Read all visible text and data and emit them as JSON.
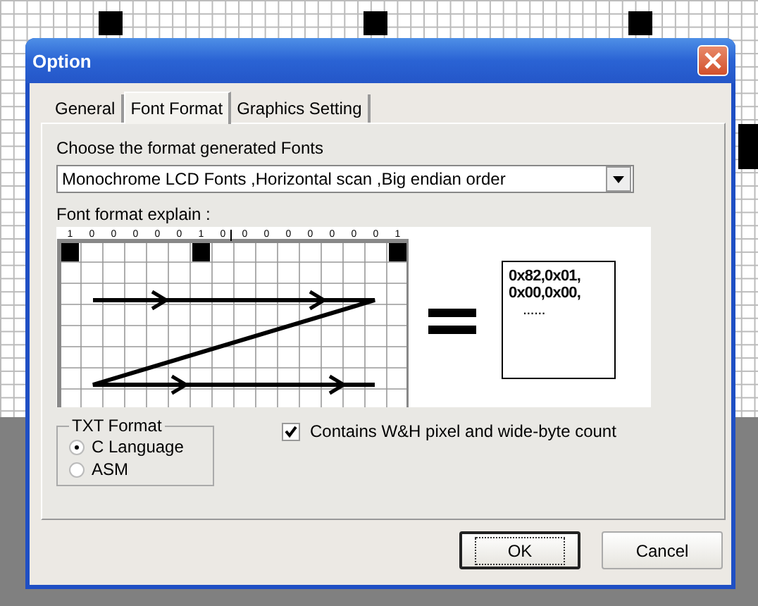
{
  "window": {
    "title": "Option"
  },
  "tabs": [
    {
      "label": "General",
      "selected": false
    },
    {
      "label": "Font Format",
      "selected": true
    },
    {
      "label": "Graphics Setting",
      "selected": false
    }
  ],
  "format": {
    "label": "Choose the format generated Fonts",
    "value": "Monochrome LCD Fonts ,Horizontal scan ,Big endian order"
  },
  "explain": {
    "label": "Font format explain :",
    "bits": [
      "1",
      "0",
      "0",
      "0",
      "0",
      "0",
      "1",
      "0",
      "0",
      "0",
      "0",
      "0",
      "0",
      "0",
      "0",
      "1"
    ],
    "output_lines": [
      "0x82,0x01,",
      "0x00,0x00,",
      "......"
    ]
  },
  "txt_format": {
    "title": "TXT Format",
    "options": [
      {
        "label": "C Language",
        "selected": true
      },
      {
        "label": "ASM",
        "selected": false
      }
    ]
  },
  "wh_checkbox": {
    "label": "Contains W&H pixel and wide-byte count",
    "checked": true
  },
  "buttons": [
    {
      "label": "OK",
      "default": true
    },
    {
      "label": "Cancel",
      "default": false
    }
  ]
}
